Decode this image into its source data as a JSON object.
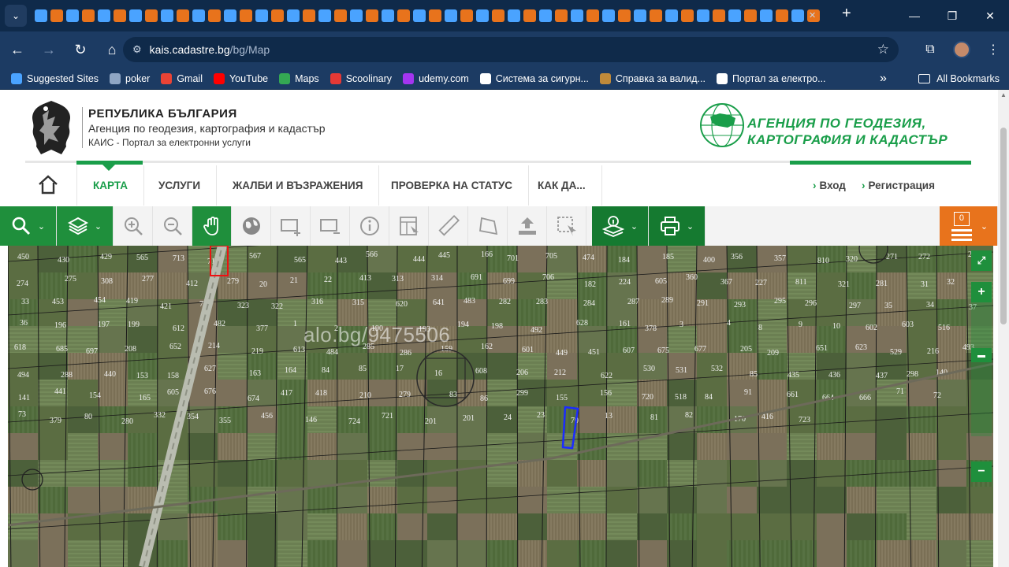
{
  "browser": {
    "url_domain": "kais.cadastre.bg",
    "url_path": "/bg/Map",
    "bookmarks": [
      {
        "label": "Suggested Sites",
        "color": "#4aa3ff"
      },
      {
        "label": "poker",
        "color": "#8fa6c4"
      },
      {
        "label": "Gmail",
        "color": "#ea4335"
      },
      {
        "label": "YouTube",
        "color": "#ff0000"
      },
      {
        "label": "Maps",
        "color": "#34a853"
      },
      {
        "label": "Scoolinary",
        "color": "#e53935"
      },
      {
        "label": "udemy.com",
        "color": "#a435f0"
      },
      {
        "label": "Система за сигурн...",
        "color": "#ffffff"
      },
      {
        "label": "Справка за валид...",
        "color": "#c08a3a"
      },
      {
        "label": "Портал за електро...",
        "color": "#ffffff"
      }
    ],
    "all_bookmarks": "All Bookmarks",
    "more_bookmarks": "»"
  },
  "header": {
    "gov_line1": "РЕПУБЛИКА БЪЛГАРИЯ",
    "gov_line2": "Агенция по геодезия, картография и кадастър",
    "gov_line3": "КАИС - Портал за електронни услуги",
    "agency_line1": "АГЕНЦИЯ ПО ГЕОДЕЗИЯ,",
    "agency_line2": "КАРТОГРАФИЯ И КАДАСТЪР"
  },
  "nav": {
    "items": [
      "КАРТА",
      "УСЛУГИ",
      "ЖАЛБИ И ВЪЗРАЖЕНИЯ",
      "ПРОВЕРКА НА СТАТУС",
      "КАК ДА..."
    ],
    "login": "Вход",
    "register": "Регистрация"
  },
  "toolbar": {
    "selection_count": "0"
  },
  "map": {
    "watermark": "alo.bg/9475506",
    "parcels": [
      "450",
      "430",
      "429",
      "565",
      "713",
      "714",
      "567",
      "565",
      "443",
      "566",
      "444",
      "445",
      "166",
      "701",
      "705",
      "474",
      "184",
      "185",
      "400",
      "356",
      "357",
      "810",
      "320",
      "271",
      "272",
      "273",
      "274",
      "275",
      "308",
      "277",
      "412",
      "279",
      "20",
      "21",
      "22",
      "413",
      "313",
      "314",
      "691",
      "699",
      "706",
      "182",
      "224",
      "605",
      "360",
      "367",
      "227",
      "811",
      "321",
      "281",
      "31",
      "32",
      "33",
      "453",
      "454",
      "419",
      "421",
      "703",
      "323",
      "322",
      "316",
      "315",
      "620",
      "641",
      "483",
      "282",
      "283",
      "284",
      "287",
      "289",
      "291",
      "293",
      "295",
      "296",
      "297",
      "35",
      "34",
      "37",
      "36",
      "196",
      "197",
      "199",
      "612",
      "482",
      "377",
      "1",
      "2",
      "190",
      "193",
      "194",
      "198",
      "492",
      "628",
      "161",
      "378",
      "3",
      "4",
      "8",
      "9",
      "10",
      "602",
      "603",
      "516",
      "618",
      "685",
      "697",
      "208",
      "652",
      "214",
      "219",
      "613",
      "484",
      "285",
      "286",
      "159",
      "162",
      "601",
      "449",
      "451",
      "607",
      "675",
      "677",
      "205",
      "209",
      "651",
      "623",
      "529",
      "216",
      "493",
      "494",
      "288",
      "440",
      "153",
      "158",
      "627",
      "163",
      "164",
      "84",
      "85",
      "17",
      "16",
      "608",
      "206",
      "212",
      "622",
      "530",
      "531",
      "532",
      "85",
      "435",
      "436",
      "437",
      "298",
      "140",
      "141",
      "441",
      "154",
      "165",
      "605",
      "676",
      "674",
      "417",
      "418",
      "210",
      "279",
      "83",
      "86",
      "299",
      "155",
      "156",
      "720",
      "518",
      "84",
      "91",
      "661",
      "664",
      "666",
      "71",
      "72",
      "73",
      "379",
      "80",
      "280",
      "332",
      "354",
      "355",
      "456",
      "146",
      "724",
      "721",
      "201",
      "201",
      "24",
      "23",
      "70",
      "13",
      "81",
      "82",
      "170",
      "416",
      "723"
    ]
  }
}
